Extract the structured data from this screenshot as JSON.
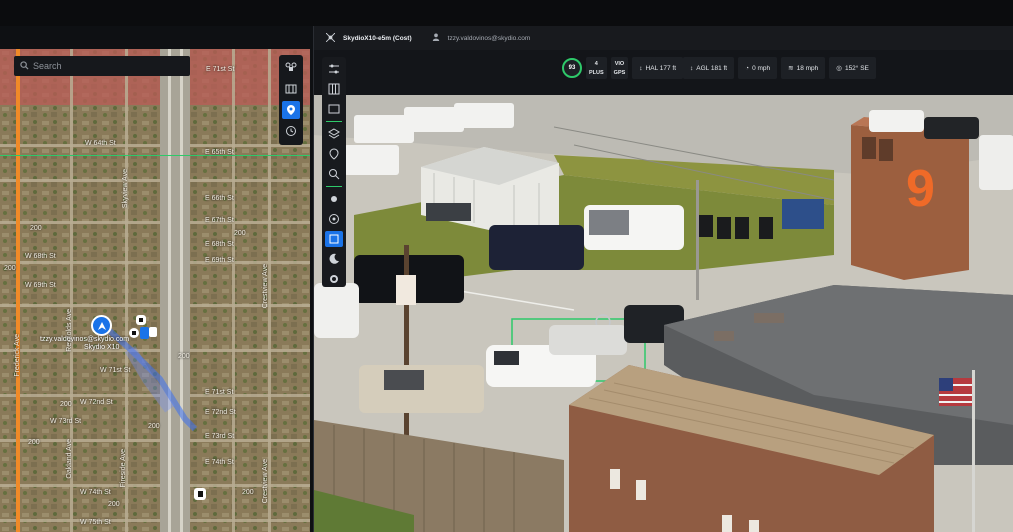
{
  "map": {
    "search_placeholder": "Search",
    "streets": {
      "e71st": "E 71st St",
      "w64th": "W 64th St",
      "e65th": "E 65th St",
      "e66th": "E 66th St",
      "e67th": "E 67th St",
      "e68th": "E 68th St",
      "e69th": "E 69th St",
      "w68th": "W 68th St",
      "w69th": "W 69th St",
      "w71st": "W 71st St",
      "w72nd": "W 72nd St",
      "w73rd": "W 73rd St",
      "e71st_b": "E 71st St",
      "e72nd": "E 72nd St",
      "e73rd": "E 73rd St",
      "e74th": "E 74th St",
      "w74th": "W 74th St",
      "w75th": "W 75th St",
      "sky_view": "Skyview Ave",
      "frederick": "Frederick Ave",
      "reynolds": "Reynolds Ave",
      "fireside": "Fireside Ave",
      "oakland": "Oakland Ave",
      "crestview": "Crestview Ave"
    },
    "numbers": {
      "n200a": "200",
      "n200b": "200",
      "n200c": "200",
      "n200d": "200",
      "n200e": "200",
      "n200f": "200",
      "n200g": "200",
      "n200h": "200",
      "n200i": "200"
    },
    "user_label_1": "tzzy.valdovinos@skydio.com",
    "user_label_2": "Skydio X10"
  },
  "video": {
    "device_name": "SkydioX10-e5m (Cost)",
    "user_email": "tzzy.valdovinos@skydio.com",
    "telemetry": {
      "battery": "93",
      "plus_badge_top": "4",
      "plus_badge_bottom": "PLUS",
      "vio_top": "VIO",
      "vio_bottom": "GPS",
      "hal": "HAL 177 ft",
      "agl": "AGL 181 ft",
      "speed": "0 mph",
      "wind": "18 mph",
      "heading": "152° SE"
    },
    "building_number": "9"
  },
  "colors": {
    "accent": "#1a73e8",
    "green": "#2ec96a"
  }
}
